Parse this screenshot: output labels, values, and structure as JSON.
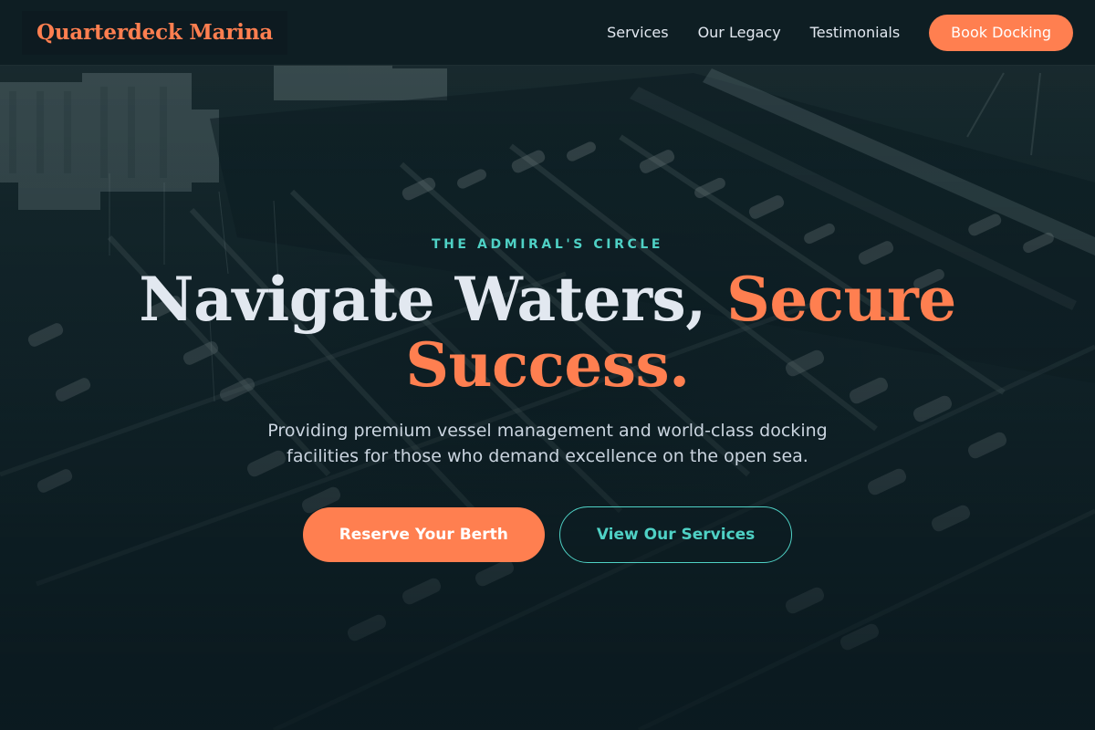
{
  "header": {
    "logo": "Quarterdeck Marina",
    "nav": [
      {
        "label": "Services"
      },
      {
        "label": "Our Legacy"
      },
      {
        "label": "Testimonials"
      }
    ],
    "cta_label": "Book Docking"
  },
  "hero": {
    "eyebrow": "The Admiral's Circle",
    "headline_part1": "Navigate Waters, ",
    "headline_accent": "Secure Success.",
    "subtitle": "Providing premium vessel management and world-class docking facilities for those who demand excellence on the open sea.",
    "primary_button": "Reserve Your Berth",
    "secondary_button": "View Our Services",
    "background_image": "aerial-marina-photo"
  },
  "colors": {
    "accent": "#ff7f50",
    "teal": "#4fd1c5",
    "background": "#0b1a20",
    "text_light": "#e2e8f0"
  }
}
